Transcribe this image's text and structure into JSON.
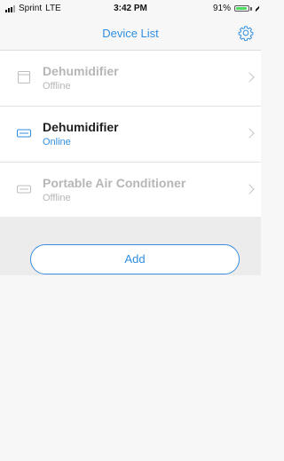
{
  "status_bar": {
    "carrier": "Sprint",
    "network": "LTE",
    "time": "3:42 PM",
    "battery": "91%",
    "battery_level": 0.91,
    "icons": [
      "signal-icon",
      "battery-icon",
      "charging-icon"
    ]
  },
  "nav": {
    "title": "Device List",
    "settings_icon": "gear-icon"
  },
  "devices": [
    {
      "name": "Dehumidifier",
      "status": "Offline",
      "online": false,
      "icon": "dehumidifier-icon"
    },
    {
      "name": "Dehumidifier",
      "status": "Online",
      "online": true,
      "icon": "air-unit-icon"
    },
    {
      "name": "Portable Air Conditioner",
      "status": "Offline",
      "online": false,
      "icon": "air-conditioner-icon"
    }
  ],
  "actions": {
    "add_label": "Add"
  },
  "colors": {
    "accent": "#2f8ee0",
    "text_dark": "#1f1f1f",
    "text_disabled": "#b6b6b6",
    "background": "#f7f7f7",
    "battery_green": "#4cd964"
  }
}
